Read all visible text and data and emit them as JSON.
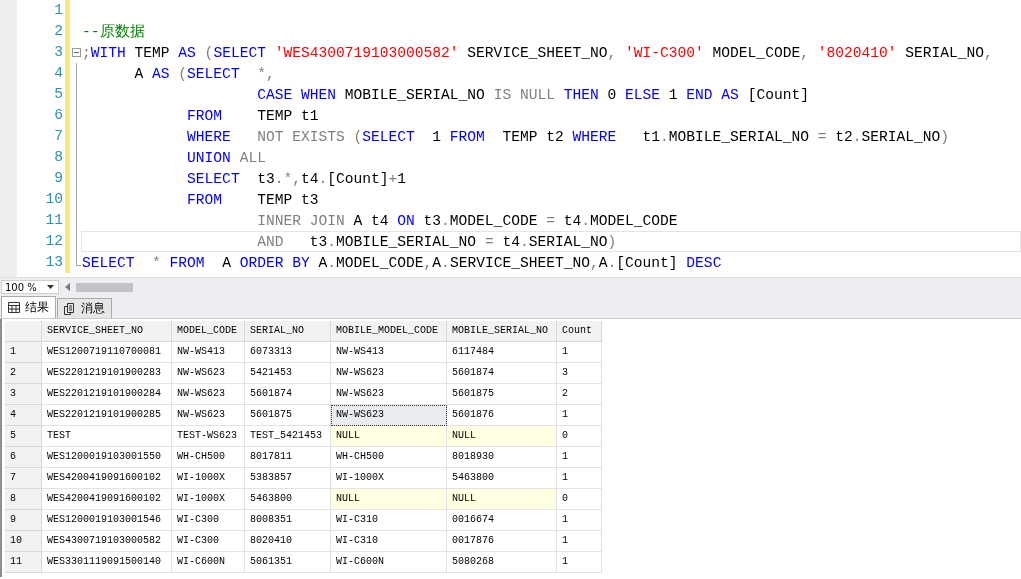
{
  "editor": {
    "lines": [
      {
        "number": "1",
        "fold_start": false,
        "current": false
      },
      {
        "number": "2",
        "fold_start": false,
        "current": false,
        "tokens": [
          {
            "kind": "comment",
            "text": "--原数据"
          }
        ]
      },
      {
        "number": "3",
        "fold_start": true,
        "current": false,
        "tokens": [
          {
            "kind": "op",
            "text": ";"
          },
          {
            "kind": "keyword",
            "text": "WITH"
          },
          {
            "kind": "ident",
            "text": " TEMP "
          },
          {
            "kind": "keyword",
            "text": "AS"
          },
          {
            "kind": "op",
            "text": " ("
          },
          {
            "kind": "keyword",
            "text": "SELECT"
          },
          {
            "kind": "string",
            "text": " 'WES4300719103000582'"
          },
          {
            "kind": "ident",
            "text": " SERVICE_SHEET_NO"
          },
          {
            "kind": "op",
            "text": ", "
          },
          {
            "kind": "string",
            "text": "'WI-C300'"
          },
          {
            "kind": "ident",
            "text": " MODEL_CODE"
          },
          {
            "kind": "op",
            "text": ", "
          },
          {
            "kind": "string",
            "text": "'8020410'"
          },
          {
            "kind": "ident",
            "text": " SERIAL_NO"
          },
          {
            "kind": "op",
            "text": ","
          }
        ]
      },
      {
        "number": "4",
        "fold_start": false,
        "current": false,
        "tokens": [
          {
            "kind": "ident",
            "text": "      A "
          },
          {
            "kind": "keyword",
            "text": "AS"
          },
          {
            "kind": "op",
            "text": " ("
          },
          {
            "kind": "keyword",
            "text": "SELECT"
          },
          {
            "kind": "op",
            "text": "  *,"
          }
        ]
      },
      {
        "number": "5",
        "fold_start": false,
        "current": false,
        "tokens": [
          {
            "kind": "keyword",
            "text": "                    CASE WHEN"
          },
          {
            "kind": "ident",
            "text": " MOBILE_SERIAL_NO "
          },
          {
            "kind": "op",
            "text": "IS NULL"
          },
          {
            "kind": "keyword",
            "text": " THEN"
          },
          {
            "kind": "ident",
            "text": " 0 "
          },
          {
            "kind": "keyword",
            "text": "ELSE"
          },
          {
            "kind": "ident",
            "text": " 1 "
          },
          {
            "kind": "keyword",
            "text": "END AS"
          },
          {
            "kind": "ident",
            "text": " [Count]"
          }
        ]
      },
      {
        "number": "6",
        "fold_start": false,
        "current": false,
        "tokens": [
          {
            "kind": "keyword",
            "text": "            FROM"
          },
          {
            "kind": "ident",
            "text": "    TEMP t1"
          }
        ]
      },
      {
        "number": "7",
        "fold_start": false,
        "current": false,
        "tokens": [
          {
            "kind": "keyword",
            "text": "            WHERE"
          },
          {
            "kind": "op",
            "text": "   NOT EXISTS ("
          },
          {
            "kind": "keyword",
            "text": "SELECT"
          },
          {
            "kind": "ident",
            "text": "  1 "
          },
          {
            "kind": "keyword",
            "text": "FROM"
          },
          {
            "kind": "ident",
            "text": "  TEMP t2 "
          },
          {
            "kind": "keyword",
            "text": "WHERE"
          },
          {
            "kind": "ident",
            "text": "   t1"
          },
          {
            "kind": "op",
            "text": "."
          },
          {
            "kind": "ident",
            "text": "MOBILE_SERIAL_NO "
          },
          {
            "kind": "op",
            "text": "="
          },
          {
            "kind": "ident",
            "text": " t2"
          },
          {
            "kind": "op",
            "text": "."
          },
          {
            "kind": "ident",
            "text": "SERIAL_NO"
          },
          {
            "kind": "op",
            "text": ")"
          }
        ]
      },
      {
        "number": "8",
        "fold_start": false,
        "current": false,
        "tokens": [
          {
            "kind": "keyword",
            "text": "            UNION"
          },
          {
            "kind": "op",
            "text": " ALL"
          }
        ]
      },
      {
        "number": "9",
        "fold_start": false,
        "current": false,
        "tokens": [
          {
            "kind": "keyword",
            "text": "            SELECT"
          },
          {
            "kind": "ident",
            "text": "  t3"
          },
          {
            "kind": "op",
            "text": ".*,"
          },
          {
            "kind": "ident",
            "text": "t4"
          },
          {
            "kind": "op",
            "text": "."
          },
          {
            "kind": "ident",
            "text": "[Count]"
          },
          {
            "kind": "op",
            "text": "+"
          },
          {
            "kind": "ident",
            "text": "1"
          }
        ]
      },
      {
        "number": "10",
        "fold_start": false,
        "current": false,
        "tokens": [
          {
            "kind": "keyword",
            "text": "            FROM"
          },
          {
            "kind": "ident",
            "text": "    TEMP t3"
          }
        ]
      },
      {
        "number": "11",
        "fold_start": false,
        "current": false,
        "tokens": [
          {
            "kind": "op",
            "text": "                    INNER JOIN"
          },
          {
            "kind": "ident",
            "text": " A t4 "
          },
          {
            "kind": "keyword",
            "text": "ON"
          },
          {
            "kind": "ident",
            "text": " t3"
          },
          {
            "kind": "op",
            "text": "."
          },
          {
            "kind": "ident",
            "text": "MODEL_CODE "
          },
          {
            "kind": "op",
            "text": "="
          },
          {
            "kind": "ident",
            "text": " t4"
          },
          {
            "kind": "op",
            "text": "."
          },
          {
            "kind": "ident",
            "text": "MODEL_CODE"
          }
        ]
      },
      {
        "number": "12",
        "fold_start": false,
        "current": true,
        "tokens": [
          {
            "kind": "op",
            "text": "                    AND"
          },
          {
            "kind": "ident",
            "text": "   t3"
          },
          {
            "kind": "op",
            "text": "."
          },
          {
            "kind": "ident",
            "text": "MOBILE_SERIAL_NO "
          },
          {
            "kind": "op",
            "text": "="
          },
          {
            "kind": "ident",
            "text": " t4"
          },
          {
            "kind": "op",
            "text": "."
          },
          {
            "kind": "ident",
            "text": "SERIAL_NO"
          },
          {
            "kind": "op",
            "text": ")"
          }
        ]
      },
      {
        "number": "13",
        "fold_start": false,
        "current": false,
        "tokens": [
          {
            "kind": "keyword",
            "text": "SELECT"
          },
          {
            "kind": "op",
            "text": "  *"
          },
          {
            "kind": "keyword",
            "text": " FROM"
          },
          {
            "kind": "ident",
            "text": "  A "
          },
          {
            "kind": "keyword",
            "text": "ORDER BY"
          },
          {
            "kind": "ident",
            "text": " A"
          },
          {
            "kind": "op",
            "text": "."
          },
          {
            "kind": "ident",
            "text": "MODEL_CODE"
          },
          {
            "kind": "op",
            "text": ","
          },
          {
            "kind": "ident",
            "text": "A"
          },
          {
            "kind": "op",
            "text": "."
          },
          {
            "kind": "ident",
            "text": "SERVICE_SHEET_NO"
          },
          {
            "kind": "op",
            "text": ","
          },
          {
            "kind": "ident",
            "text": "A"
          },
          {
            "kind": "op",
            "text": "."
          },
          {
            "kind": "ident",
            "text": "[Count] "
          },
          {
            "kind": "keyword",
            "text": "DESC"
          }
        ]
      }
    ]
  },
  "zoom": {
    "value": "100 %"
  },
  "tabs": [
    {
      "label": "结果",
      "selected": true,
      "kind": "grid"
    },
    {
      "label": "消息",
      "selected": false,
      "kind": "messages"
    }
  ],
  "table": {
    "columns": [
      "SERVICE_SHEET_NO",
      "MODEL_CODE",
      "SERIAL_NO",
      "MOBILE_MODEL_CODE",
      "MOBILE_SERIAL_NO",
      "Count"
    ],
    "rows": [
      {
        "number": "1",
        "cells": [
          {
            "text": "WES1200719110700081",
            "is_null": false,
            "focused": false
          },
          {
            "text": "NW-WS413",
            "is_null": false,
            "focused": false
          },
          {
            "text": "6073313",
            "is_null": false,
            "focused": false
          },
          {
            "text": "NW-WS413",
            "is_null": false,
            "focused": false
          },
          {
            "text": "6117484",
            "is_null": false,
            "focused": false
          },
          {
            "text": "1",
            "is_null": false,
            "focused": false
          }
        ]
      },
      {
        "number": "2",
        "cells": [
          {
            "text": "WES2201219101900283",
            "is_null": false,
            "focused": false
          },
          {
            "text": "NW-WS623",
            "is_null": false,
            "focused": false
          },
          {
            "text": "5421453",
            "is_null": false,
            "focused": false
          },
          {
            "text": "NW-WS623",
            "is_null": false,
            "focused": false
          },
          {
            "text": "5601874",
            "is_null": false,
            "focused": false
          },
          {
            "text": "3",
            "is_null": false,
            "focused": false
          }
        ]
      },
      {
        "number": "3",
        "cells": [
          {
            "text": "WES2201219101900284",
            "is_null": false,
            "focused": false
          },
          {
            "text": "NW-WS623",
            "is_null": false,
            "focused": false
          },
          {
            "text": "5601874",
            "is_null": false,
            "focused": false
          },
          {
            "text": "NW-WS623",
            "is_null": false,
            "focused": false
          },
          {
            "text": "5601875",
            "is_null": false,
            "focused": false
          },
          {
            "text": "2",
            "is_null": false,
            "focused": false
          }
        ]
      },
      {
        "number": "4",
        "cells": [
          {
            "text": "WES2201219101900285",
            "is_null": false,
            "focused": false
          },
          {
            "text": "NW-WS623",
            "is_null": false,
            "focused": false
          },
          {
            "text": "5601875",
            "is_null": false,
            "focused": false
          },
          {
            "text": "NW-WS623",
            "is_null": false,
            "focused": true
          },
          {
            "text": "5601876",
            "is_null": false,
            "focused": false
          },
          {
            "text": "1",
            "is_null": false,
            "focused": false
          }
        ]
      },
      {
        "number": "5",
        "cells": [
          {
            "text": "TEST",
            "is_null": false,
            "focused": false
          },
          {
            "text": "TEST-WS623",
            "is_null": false,
            "focused": false
          },
          {
            "text": "TEST_5421453",
            "is_null": false,
            "focused": false
          },
          {
            "text": "NULL",
            "is_null": true,
            "focused": false
          },
          {
            "text": "NULL",
            "is_null": true,
            "focused": false
          },
          {
            "text": "0",
            "is_null": false,
            "focused": false
          }
        ]
      },
      {
        "number": "6",
        "cells": [
          {
            "text": "WES1200019103001550",
            "is_null": false,
            "focused": false
          },
          {
            "text": "WH-CH500",
            "is_null": false,
            "focused": false
          },
          {
            "text": "8017811",
            "is_null": false,
            "focused": false
          },
          {
            "text": "WH-CH500",
            "is_null": false,
            "focused": false
          },
          {
            "text": "8018930",
            "is_null": false,
            "focused": false
          },
          {
            "text": "1",
            "is_null": false,
            "focused": false
          }
        ]
      },
      {
        "number": "7",
        "cells": [
          {
            "text": "WES4200419091600102",
            "is_null": false,
            "focused": false
          },
          {
            "text": "WI-1000X",
            "is_null": false,
            "focused": false
          },
          {
            "text": "5383857",
            "is_null": false,
            "focused": false
          },
          {
            "text": "WI-1000X",
            "is_null": false,
            "focused": false
          },
          {
            "text": "5463800",
            "is_null": false,
            "focused": false
          },
          {
            "text": "1",
            "is_null": false,
            "focused": false
          }
        ]
      },
      {
        "number": "8",
        "cells": [
          {
            "text": "WES4200419091600102",
            "is_null": false,
            "focused": false
          },
          {
            "text": "WI-1000X",
            "is_null": false,
            "focused": false
          },
          {
            "text": "5463800",
            "is_null": false,
            "focused": false
          },
          {
            "text": "NULL",
            "is_null": true,
            "focused": false
          },
          {
            "text": "NULL",
            "is_null": true,
            "focused": false
          },
          {
            "text": "0",
            "is_null": false,
            "focused": false
          }
        ]
      },
      {
        "number": "9",
        "cells": [
          {
            "text": "WES1200019103001546",
            "is_null": false,
            "focused": false
          },
          {
            "text": "WI-C300",
            "is_null": false,
            "focused": false
          },
          {
            "text": "8008351",
            "is_null": false,
            "focused": false
          },
          {
            "text": "WI-C310",
            "is_null": false,
            "focused": false
          },
          {
            "text": "0016674",
            "is_null": false,
            "focused": false
          },
          {
            "text": "1",
            "is_null": false,
            "focused": false
          }
        ]
      },
      {
        "number": "10",
        "cells": [
          {
            "text": "WES4300719103000582",
            "is_null": false,
            "focused": false
          },
          {
            "text": "WI-C300",
            "is_null": false,
            "focused": false
          },
          {
            "text": "8020410",
            "is_null": false,
            "focused": false
          },
          {
            "text": "WI-C310",
            "is_null": false,
            "focused": false
          },
          {
            "text": "0017876",
            "is_null": false,
            "focused": false
          },
          {
            "text": "1",
            "is_null": false,
            "focused": false
          }
        ]
      },
      {
        "number": "11",
        "cells": [
          {
            "text": "WES3301119091500140",
            "is_null": false,
            "focused": false
          },
          {
            "text": "WI-C600N",
            "is_null": false,
            "focused": false
          },
          {
            "text": "5061351",
            "is_null": false,
            "focused": false
          },
          {
            "text": "WI-C600N",
            "is_null": false,
            "focused": false
          },
          {
            "text": "5080268",
            "is_null": false,
            "focused": false
          },
          {
            "text": "1",
            "is_null": false,
            "focused": false
          }
        ]
      }
    ]
  }
}
